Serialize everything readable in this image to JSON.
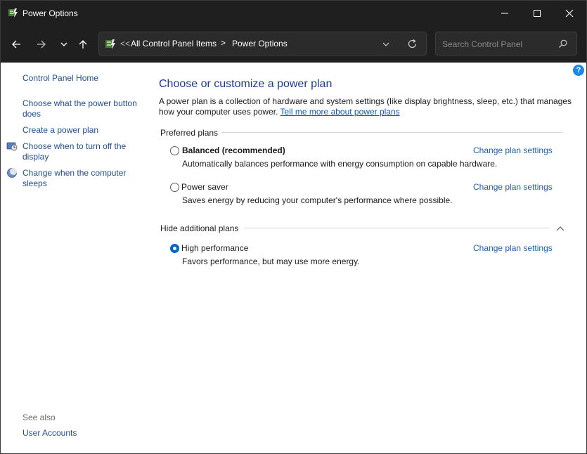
{
  "window": {
    "title": "Power Options"
  },
  "address": {
    "overflow": "<<",
    "crumbs": [
      "All Control Panel Items",
      "Power Options"
    ],
    "separator": ">"
  },
  "search": {
    "placeholder": "Search Control Panel"
  },
  "help": {
    "label": "?"
  },
  "sidebar": {
    "home": "Control Panel Home",
    "items": [
      "Choose what the power button does",
      "Create a power plan",
      "Choose when to turn off the display",
      "Change when the computer sleeps"
    ],
    "see_also_label": "See also",
    "see_also_items": [
      "User Accounts"
    ]
  },
  "main": {
    "title": "Choose or customize a power plan",
    "description": "A power plan is a collection of hardware and system settings (like display brightness, sleep, etc.) that manages how your computer uses power.",
    "learn_more": "Tell me more about power plans",
    "preferred_label": "Preferred plans",
    "additional_label": "Hide additional plans",
    "plans": [
      {
        "name": "Balanced (recommended)",
        "description": "Automatically balances performance with energy consumption on capable hardware.",
        "link": "Change plan settings",
        "selected": false
      },
      {
        "name": "Power saver",
        "description": "Saves energy by reducing your computer's performance where possible.",
        "link": "Change plan settings",
        "selected": false
      },
      {
        "name": "High performance",
        "description": "Favors performance, but may use more energy.",
        "link": "Change plan settings",
        "selected": true
      }
    ]
  },
  "colors": {
    "titlebar": "#1f1f1f",
    "link": "#1f4e8c",
    "title": "#1e3a8a",
    "accent": "#0067c0"
  }
}
